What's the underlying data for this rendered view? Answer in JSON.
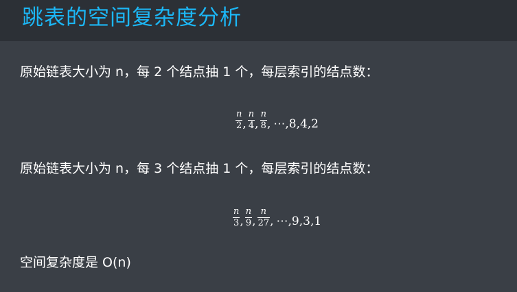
{
  "slide": {
    "title": "跳表的空间复杂度分析",
    "paragraph_1": "原始链表大小为 n，每 2 个结点抽 1 个，每层索引的结点数：",
    "formula_1": {
      "fractions": [
        {
          "numerator": "n",
          "denominator": "2"
        },
        {
          "numerator": "n",
          "denominator": "4"
        },
        {
          "numerator": "n",
          "denominator": "8"
        }
      ],
      "tail": "⋯,8,4,2"
    },
    "paragraph_2": "原始链表大小为 n，每 3 个结点抽 1 个，每层索引的结点数：",
    "formula_2": {
      "fractions": [
        {
          "numerator": "n",
          "denominator": "3"
        },
        {
          "numerator": "n",
          "denominator": "9"
        },
        {
          "numerator": "n",
          "denominator": "27"
        }
      ],
      "tail": "⋯,9,3,1"
    },
    "conclusion": "空间复杂度是 O(n)"
  },
  "colors": {
    "background": "#3a3f46",
    "header_background": "#2c3036",
    "title": "#1cb7f6",
    "text": "#ffffff"
  }
}
